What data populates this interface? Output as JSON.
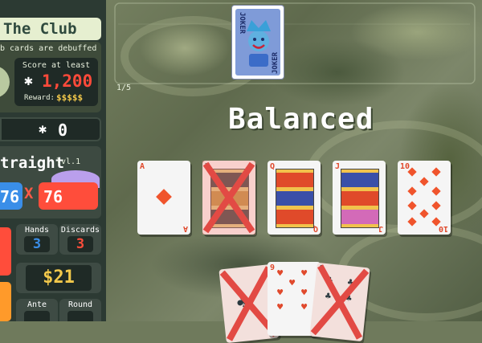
{
  "game": "Balatro",
  "colors": {
    "accent_red": "#ff4d3b",
    "chips_blue": "#3a8ee8",
    "money_gold": "#f2c84b"
  },
  "blind": {
    "name": "The Club",
    "effect": "b cards are debuffed",
    "score_label": "Score at least",
    "score_target": "1,200",
    "reward_label": "Reward:",
    "reward_value": "$$$$$"
  },
  "round_score": "0",
  "hand": {
    "name": "traight",
    "level": "lvl.1",
    "chips": "76",
    "times": "X",
    "mult": "76"
  },
  "stats": {
    "hands_label": "Hands",
    "hands_value": "3",
    "discards_label": "Discards",
    "discards_value": "3",
    "money": "$21",
    "ante_label": "Ante",
    "round_label": "Round"
  },
  "center": {
    "counter": "1/5",
    "hand_title": "Balanced",
    "joker_text": "JOKER",
    "played_cards": [
      {
        "rank": "A",
        "suit": "diamonds",
        "debuffed": false
      },
      {
        "rank": "K",
        "suit": "clubs",
        "debuffed": true
      },
      {
        "rank": "Q",
        "suit": "diamonds",
        "debuffed": false
      },
      {
        "rank": "J",
        "suit": "diamonds",
        "debuffed": false
      },
      {
        "rank": "10",
        "suit": "diamonds",
        "debuffed": false
      }
    ],
    "hand_cards": [
      {
        "rank": "A",
        "suit": "clubs",
        "debuffed": true
      },
      {
        "rank": "9",
        "suit": "hearts",
        "debuffed": false
      },
      {
        "rank": "8",
        "suit": "clubs",
        "debuffed": true
      }
    ]
  },
  "icons": [
    "star-chip-icon",
    "joker-card-icon",
    "diamond-suit-icon",
    "heart-suit-icon",
    "club-suit-icon",
    "debuff-x-icon"
  ]
}
